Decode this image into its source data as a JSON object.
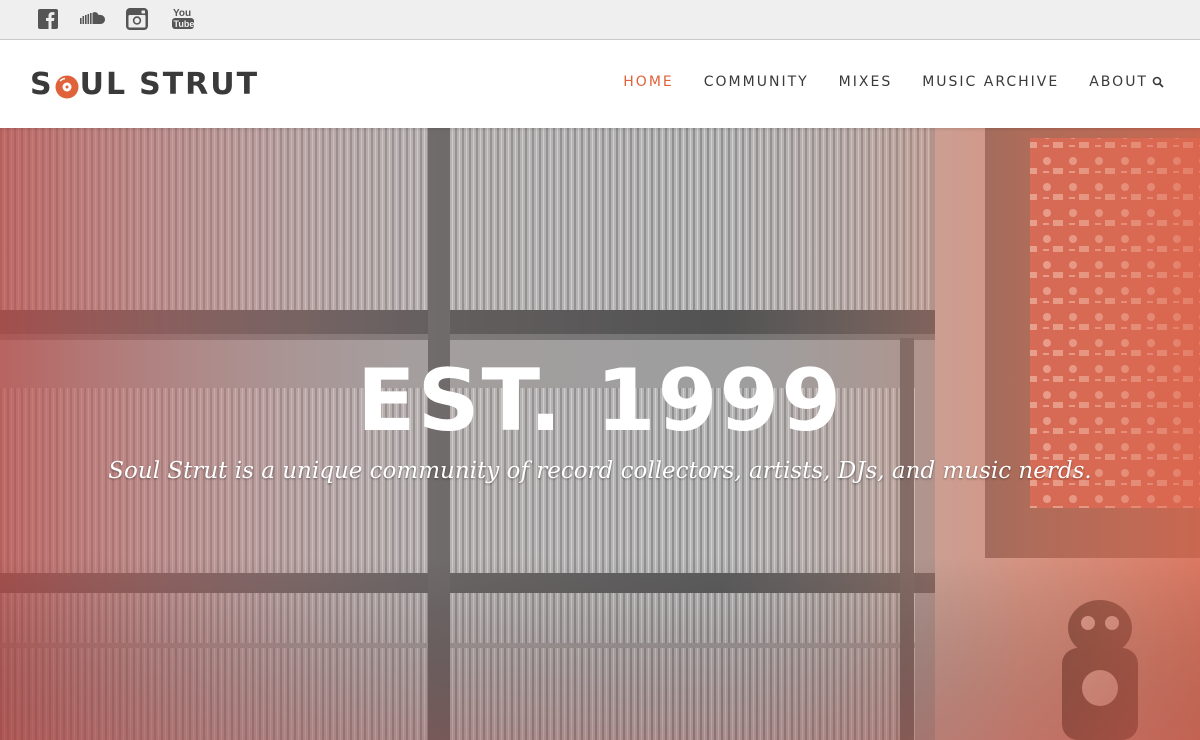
{
  "social": [
    {
      "name": "facebook-icon"
    },
    {
      "name": "soundcloud-icon"
    },
    {
      "name": "instagram-icon"
    },
    {
      "name": "youtube-icon",
      "label_top": "You",
      "label_bottom": "Tube"
    }
  ],
  "brand": {
    "part1": "S",
    "part2": "UL",
    "part3": "STRUT",
    "accent": "#e0623a",
    "text_color": "#3a3a3a"
  },
  "nav": {
    "items": [
      {
        "label": "HOME",
        "active": true
      },
      {
        "label": "COMMUNITY",
        "active": false
      },
      {
        "label": "MIXES",
        "active": false
      },
      {
        "label": "MUSIC ARCHIVE",
        "active": false
      },
      {
        "label": "ABOUT",
        "active": false
      }
    ],
    "search_icon": "search-icon"
  },
  "hero": {
    "title": "EST. 1999",
    "subtitle": "Soul Strut is a unique community of record collectors, artists, DJs, and music nerds.",
    "overlay_colors": [
      "#c25a55",
      "#a8a8a8",
      "#e0785a"
    ]
  }
}
